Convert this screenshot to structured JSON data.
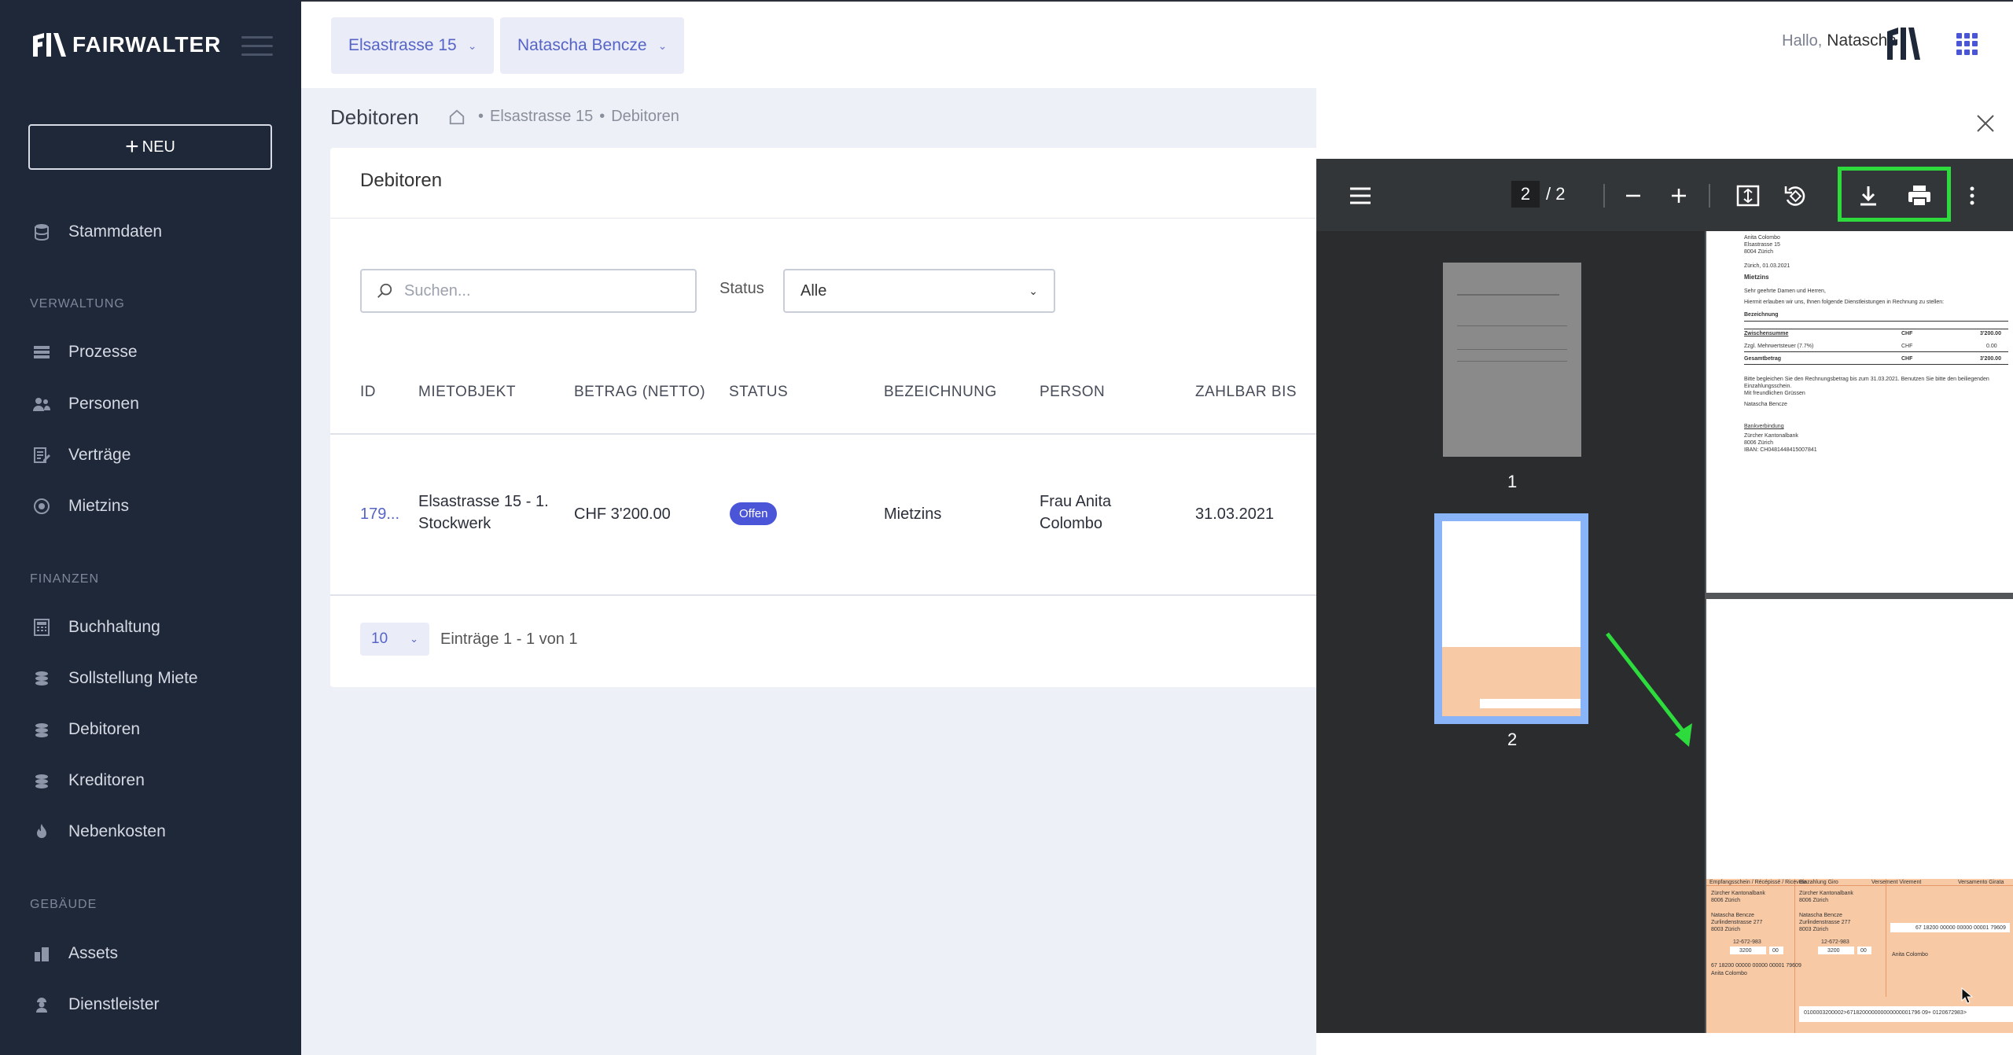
{
  "app": {
    "brand": "FAIRWALTER",
    "new_button": "NEU"
  },
  "sidebar": {
    "top_item": "Stammdaten",
    "sections": [
      {
        "title": "VERWALTUNG",
        "items": [
          "Prozesse",
          "Personen",
          "Verträge",
          "Mietzins"
        ]
      },
      {
        "title": "FINANZEN",
        "items": [
          "Buchhaltung",
          "Sollstellung Miete",
          "Debitoren",
          "Kreditoren",
          "Nebenkosten"
        ]
      },
      {
        "title": "GEBÄUDE",
        "items": [
          "Assets",
          "Dienstleister"
        ]
      }
    ]
  },
  "topbar": {
    "property_select": "Elsastrasse 15",
    "user_select": "Natascha Bencze",
    "greeting": "Hallo,",
    "user_name": "Natascha"
  },
  "page": {
    "title": "Debitoren",
    "breadcrumb": [
      "Elsastrasse 15",
      "Debitoren"
    ]
  },
  "card": {
    "title": "Debitoren",
    "search_placeholder": "Suchen...",
    "status_label": "Status",
    "status_value": "Alle",
    "columns": [
      "ID",
      "MIETOBJEKT",
      "BETRAG (NETTO)",
      "STATUS",
      "BEZEICHNUNG",
      "PERSON",
      "ZAHLBAR BIS"
    ],
    "rows": [
      {
        "id": "179...",
        "mietobjekt_l1": "Elsastrasse 15 - 1.",
        "mietobjekt_l2": "Stockwerk",
        "betrag": "CHF 3'200.00",
        "status": "Offen",
        "bezeichnung": "Mietzins",
        "person_l1": "Frau Anita",
        "person_l2": "Colombo",
        "zahlbar_bis": "31.03.2021"
      }
    ],
    "page_size": "10",
    "entries_text": "Einträge 1 - 1 von 1"
  },
  "viewer": {
    "current_page": "2",
    "page_of": "/  2",
    "thumb_labels": [
      "1",
      "2"
    ],
    "highlight_color": "#2ddc3c"
  },
  "pdf_page1": {
    "address": [
      "Anita Colombo",
      "Elsastrasse 15",
      "8004 Zürich"
    ],
    "date": "Zürich, 01.03.2021",
    "subject": "Mietzins",
    "salutation": "Sehr geehrte Damen und Herren,",
    "intro": "Hiermit erlauben wir uns, Ihnen folgende Dienstleistungen in Rechnung zu stellen:",
    "table_header": "Bezeichnung",
    "lines": [
      {
        "label": "Zwischensumme",
        "cur": "CHF",
        "amount": "3'200.00"
      },
      {
        "label": "Zzgl. Mehrwertsteuer (7.7%)",
        "cur": "CHF",
        "amount": "0.00"
      },
      {
        "label": "Gesamtbetrag",
        "cur": "CHF",
        "amount": "3'200.00"
      }
    ],
    "closing": "Bitte begleichen Sie den Rechnungsbetrag bis zum 31.03.2021. Benutzen Sie bitte den beiliegenden Einzahlungsschein.",
    "greeting": "Mit freundlichen Grüssen",
    "signer": "Natascha Bencze",
    "bank_title": "Bankverbindung",
    "bank": [
      "Zürcher Kantonalbank",
      "8006 Zürich",
      "IBAN: CH0481448415007841"
    ]
  },
  "pdf_page2": {
    "slip_heads": [
      "Empfangsschein / Récépissé / Ricevuta",
      "Einzahlung Giro",
      "Versement Virement",
      "Versamento Girata"
    ],
    "bank": [
      "Zürcher Kantonalbank",
      "8006 Zürich"
    ],
    "payee": [
      "Natascha Bencze",
      "Zurlindenstrasse 277",
      "8003 Zürich"
    ],
    "account": "12-672-983",
    "amount": "3200",
    "cents": "00",
    "ref": "67 18200 00000 00000 00001 79609",
    "payer": "Anita Colombo",
    "code_line": "0100003200002>671820000000000000001796 09+ 0120672983>"
  }
}
